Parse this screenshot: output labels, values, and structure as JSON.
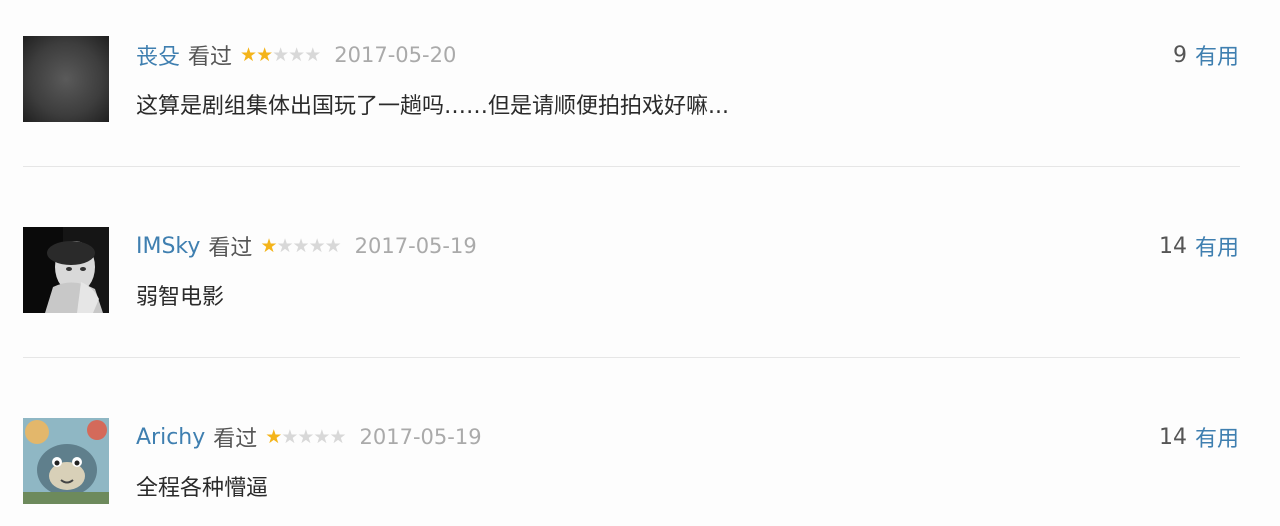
{
  "comments": [
    {
      "username": "丧殳",
      "watched_label": "看过",
      "rating": 2,
      "rating_max": 5,
      "date": "2017-05-20",
      "vote_count": "9",
      "vote_label": "有用",
      "text": "这算是剧组集体出国玩了一趟吗……但是请顺便拍拍戏好嘛..."
    },
    {
      "username": "IMSky",
      "watched_label": "看过",
      "rating": 1,
      "rating_max": 5,
      "date": "2017-05-19",
      "vote_count": "14",
      "vote_label": "有用",
      "text": "弱智电影"
    },
    {
      "username": "Arichy",
      "watched_label": "看过",
      "rating": 1,
      "rating_max": 5,
      "date": "2017-05-19",
      "vote_count": "14",
      "vote_label": "有用",
      "text": "全程各种懵逼"
    }
  ],
  "icons": {
    "star_filled": "star-filled-icon",
    "star_empty": "star-empty-icon"
  },
  "colors": {
    "link": "#3f7fb0",
    "star": "#f4b41a",
    "star_empty": "#d8d8d8",
    "date": "#aaaaaa",
    "text": "#2b2b2b",
    "divider": "#e6e6e6"
  }
}
